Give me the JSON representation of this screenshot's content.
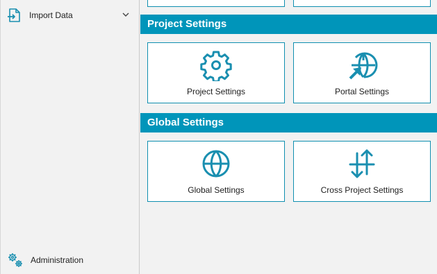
{
  "sidebar": {
    "import_label": "Import Data",
    "admin_label": "Administration"
  },
  "sections": [
    {
      "title": "Project Settings",
      "tiles": [
        {
          "label": "Project Settings",
          "icon": "gear-icon"
        },
        {
          "label": "Portal Settings",
          "icon": "globe-arrow-icon"
        }
      ]
    },
    {
      "title": "Global Settings",
      "tiles": [
        {
          "label": "Global Settings",
          "icon": "globe-icon"
        },
        {
          "label": "Cross Project Settings",
          "icon": "sort-arrows-icon"
        }
      ]
    }
  ],
  "colors": {
    "accent": "#0095ba",
    "tile_border": "#0f8fb0",
    "icon": "#1a8fb0"
  }
}
